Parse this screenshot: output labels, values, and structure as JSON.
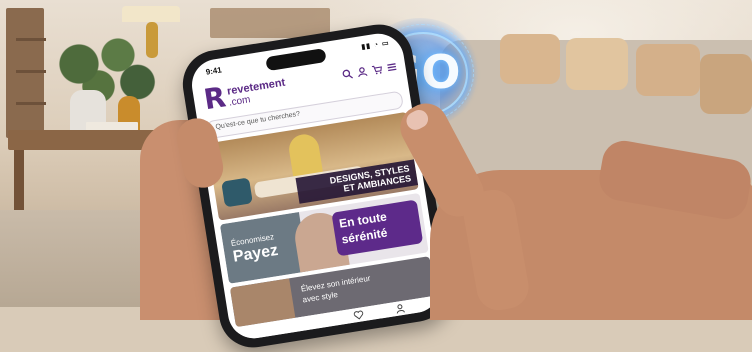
{
  "colors": {
    "brand": "#5b2a86",
    "caption_bg": "#28193a",
    "go_glow": "#3b8ff0"
  },
  "badge": {
    "label": "GO"
  },
  "phone": {
    "status": {
      "time": "9:41",
      "system": "▮▮ ◔ ▭"
    },
    "header": {
      "logo_mark": "R",
      "logo_line1": "revetement",
      "logo_line2": ".com",
      "icons": [
        "search-icon",
        "user-icon",
        "cart-icon",
        "menu-icon"
      ]
    },
    "search": {
      "placeholder": "Qu'est-ce que tu cherches?"
    },
    "banners": {
      "styles": {
        "line1": "DESIGNS, STYLES",
        "line2": "ET AMBIANCES"
      },
      "payment": {
        "small": "Économisez",
        "big": "Payez",
        "right_line1": "En toute",
        "right_line2": "sérénité"
      },
      "interior": {
        "line1": "Élevez son intérieur",
        "line2": "avec style"
      }
    },
    "tabbar": {
      "icons": [
        "favorites-icon",
        "account-icon"
      ]
    }
  }
}
